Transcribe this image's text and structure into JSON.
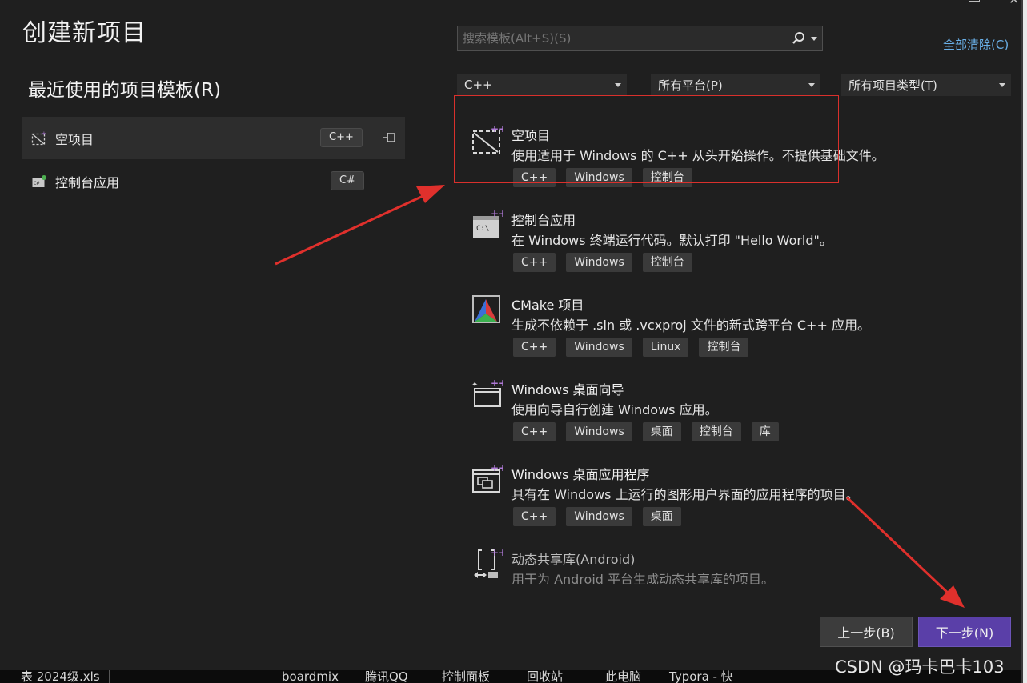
{
  "page_title": "创建新项目",
  "recent": {
    "title": "最近使用的项目模板(R)",
    "items": [
      {
        "label": "空项目",
        "tag": "C++",
        "pinned": true
      },
      {
        "label": "控制台应用",
        "tag": "C#"
      }
    ]
  },
  "search": {
    "placeholder": "搜索模板(Alt+S)(S)"
  },
  "clear_all": "全部清除(C)",
  "filters": {
    "language": "C++",
    "platform": "所有平台(P)",
    "project_type": "所有项目类型(T)"
  },
  "templates": [
    {
      "name": "空项目",
      "desc": "使用适用于 Windows 的 C++ 从头开始操作。不提供基础文件。",
      "tags": [
        "C++",
        "Windows",
        "控制台"
      ]
    },
    {
      "name": "控制台应用",
      "desc": "在 Windows 终端运行代码。默认打印 \"Hello World\"。",
      "tags": [
        "C++",
        "Windows",
        "控制台"
      ]
    },
    {
      "name": "CMake 项目",
      "desc": "生成不依赖于 .sln 或 .vcxproj 文件的新式跨平台 C++ 应用。",
      "tags": [
        "C++",
        "Windows",
        "Linux",
        "控制台"
      ]
    },
    {
      "name": "Windows 桌面向导",
      "desc": "使用向导自行创建 Windows 应用。",
      "tags": [
        "C++",
        "Windows",
        "桌面",
        "控制台",
        "库"
      ]
    },
    {
      "name": "Windows 桌面应用程序",
      "desc": "具有在 Windows 上运行的图形用户界面的应用程序的项目。",
      "tags": [
        "C++",
        "Windows",
        "桌面"
      ]
    },
    {
      "name": "动态共享库(Android)",
      "desc": "用于为 Android 平台生成动态共享库的项目。",
      "tags": []
    }
  ],
  "buttons": {
    "back": "上一步(B)",
    "next": "下一步(N)"
  },
  "taskbar": {
    "items": [
      "表 2024级.xls",
      "boardmix",
      "腾讯QQ",
      "控制面板",
      "回收站",
      "此电脑",
      "Typora - 快"
    ]
  },
  "watermark": "CSDN @玛卡巴卡103",
  "colors": {
    "accent": "#5a3fa8",
    "link": "#6ab0e8",
    "annotation": "#d9302c"
  }
}
